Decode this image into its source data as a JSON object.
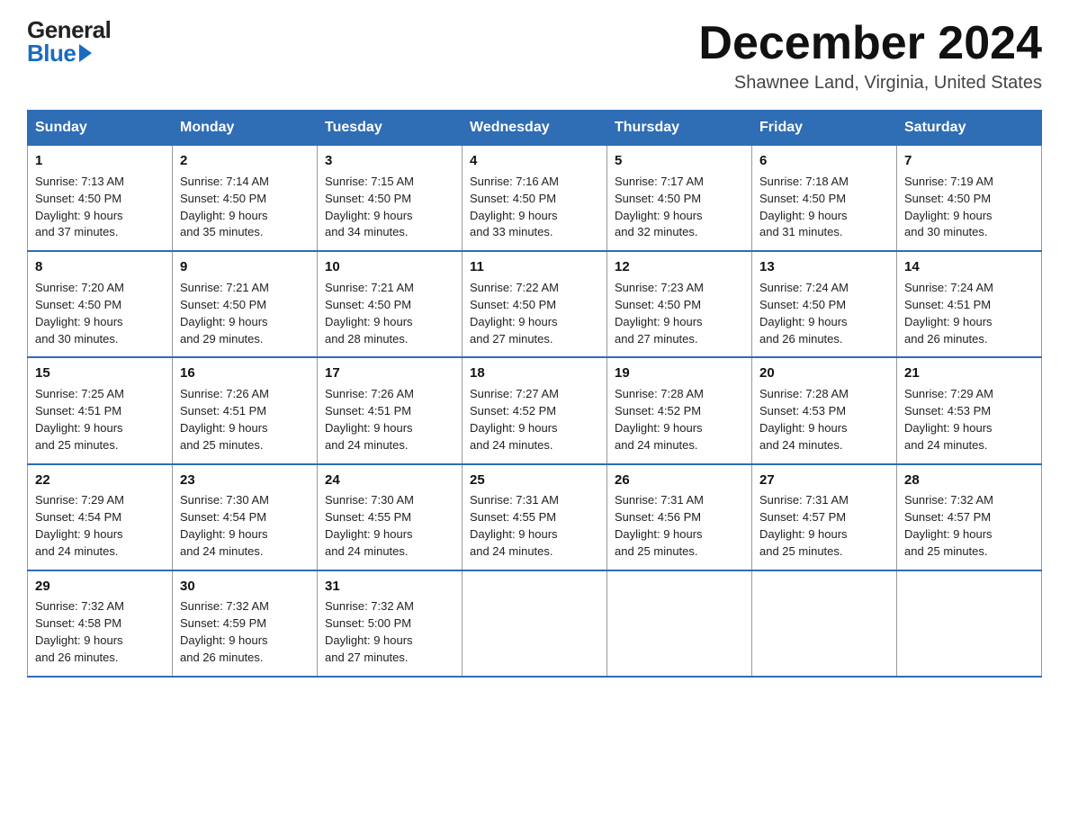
{
  "header": {
    "logo_general": "General",
    "logo_blue": "Blue",
    "month_title": "December 2024",
    "location": "Shawnee Land, Virginia, United States"
  },
  "days_of_week": [
    "Sunday",
    "Monday",
    "Tuesday",
    "Wednesday",
    "Thursday",
    "Friday",
    "Saturday"
  ],
  "weeks": [
    [
      {
        "day": "1",
        "sunrise": "7:13 AM",
        "sunset": "4:50 PM",
        "daylight": "9 hours and 37 minutes."
      },
      {
        "day": "2",
        "sunrise": "7:14 AM",
        "sunset": "4:50 PM",
        "daylight": "9 hours and 35 minutes."
      },
      {
        "day": "3",
        "sunrise": "7:15 AM",
        "sunset": "4:50 PM",
        "daylight": "9 hours and 34 minutes."
      },
      {
        "day": "4",
        "sunrise": "7:16 AM",
        "sunset": "4:50 PM",
        "daylight": "9 hours and 33 minutes."
      },
      {
        "day": "5",
        "sunrise": "7:17 AM",
        "sunset": "4:50 PM",
        "daylight": "9 hours and 32 minutes."
      },
      {
        "day": "6",
        "sunrise": "7:18 AM",
        "sunset": "4:50 PM",
        "daylight": "9 hours and 31 minutes."
      },
      {
        "day": "7",
        "sunrise": "7:19 AM",
        "sunset": "4:50 PM",
        "daylight": "9 hours and 30 minutes."
      }
    ],
    [
      {
        "day": "8",
        "sunrise": "7:20 AM",
        "sunset": "4:50 PM",
        "daylight": "9 hours and 30 minutes."
      },
      {
        "day": "9",
        "sunrise": "7:21 AM",
        "sunset": "4:50 PM",
        "daylight": "9 hours and 29 minutes."
      },
      {
        "day": "10",
        "sunrise": "7:21 AM",
        "sunset": "4:50 PM",
        "daylight": "9 hours and 28 minutes."
      },
      {
        "day": "11",
        "sunrise": "7:22 AM",
        "sunset": "4:50 PM",
        "daylight": "9 hours and 27 minutes."
      },
      {
        "day": "12",
        "sunrise": "7:23 AM",
        "sunset": "4:50 PM",
        "daylight": "9 hours and 27 minutes."
      },
      {
        "day": "13",
        "sunrise": "7:24 AM",
        "sunset": "4:50 PM",
        "daylight": "9 hours and 26 minutes."
      },
      {
        "day": "14",
        "sunrise": "7:24 AM",
        "sunset": "4:51 PM",
        "daylight": "9 hours and 26 minutes."
      }
    ],
    [
      {
        "day": "15",
        "sunrise": "7:25 AM",
        "sunset": "4:51 PM",
        "daylight": "9 hours and 25 minutes."
      },
      {
        "day": "16",
        "sunrise": "7:26 AM",
        "sunset": "4:51 PM",
        "daylight": "9 hours and 25 minutes."
      },
      {
        "day": "17",
        "sunrise": "7:26 AM",
        "sunset": "4:51 PM",
        "daylight": "9 hours and 24 minutes."
      },
      {
        "day": "18",
        "sunrise": "7:27 AM",
        "sunset": "4:52 PM",
        "daylight": "9 hours and 24 minutes."
      },
      {
        "day": "19",
        "sunrise": "7:28 AM",
        "sunset": "4:52 PM",
        "daylight": "9 hours and 24 minutes."
      },
      {
        "day": "20",
        "sunrise": "7:28 AM",
        "sunset": "4:53 PM",
        "daylight": "9 hours and 24 minutes."
      },
      {
        "day": "21",
        "sunrise": "7:29 AM",
        "sunset": "4:53 PM",
        "daylight": "9 hours and 24 minutes."
      }
    ],
    [
      {
        "day": "22",
        "sunrise": "7:29 AM",
        "sunset": "4:54 PM",
        "daylight": "9 hours and 24 minutes."
      },
      {
        "day": "23",
        "sunrise": "7:30 AM",
        "sunset": "4:54 PM",
        "daylight": "9 hours and 24 minutes."
      },
      {
        "day": "24",
        "sunrise": "7:30 AM",
        "sunset": "4:55 PM",
        "daylight": "9 hours and 24 minutes."
      },
      {
        "day": "25",
        "sunrise": "7:31 AM",
        "sunset": "4:55 PM",
        "daylight": "9 hours and 24 minutes."
      },
      {
        "day": "26",
        "sunrise": "7:31 AM",
        "sunset": "4:56 PM",
        "daylight": "9 hours and 25 minutes."
      },
      {
        "day": "27",
        "sunrise": "7:31 AM",
        "sunset": "4:57 PM",
        "daylight": "9 hours and 25 minutes."
      },
      {
        "day": "28",
        "sunrise": "7:32 AM",
        "sunset": "4:57 PM",
        "daylight": "9 hours and 25 minutes."
      }
    ],
    [
      {
        "day": "29",
        "sunrise": "7:32 AM",
        "sunset": "4:58 PM",
        "daylight": "9 hours and 26 minutes."
      },
      {
        "day": "30",
        "sunrise": "7:32 AM",
        "sunset": "4:59 PM",
        "daylight": "9 hours and 26 minutes."
      },
      {
        "day": "31",
        "sunrise": "7:32 AM",
        "sunset": "5:00 PM",
        "daylight": "9 hours and 27 minutes."
      },
      null,
      null,
      null,
      null
    ]
  ],
  "labels": {
    "sunrise": "Sunrise:",
    "sunset": "Sunset:",
    "daylight": "Daylight:"
  }
}
